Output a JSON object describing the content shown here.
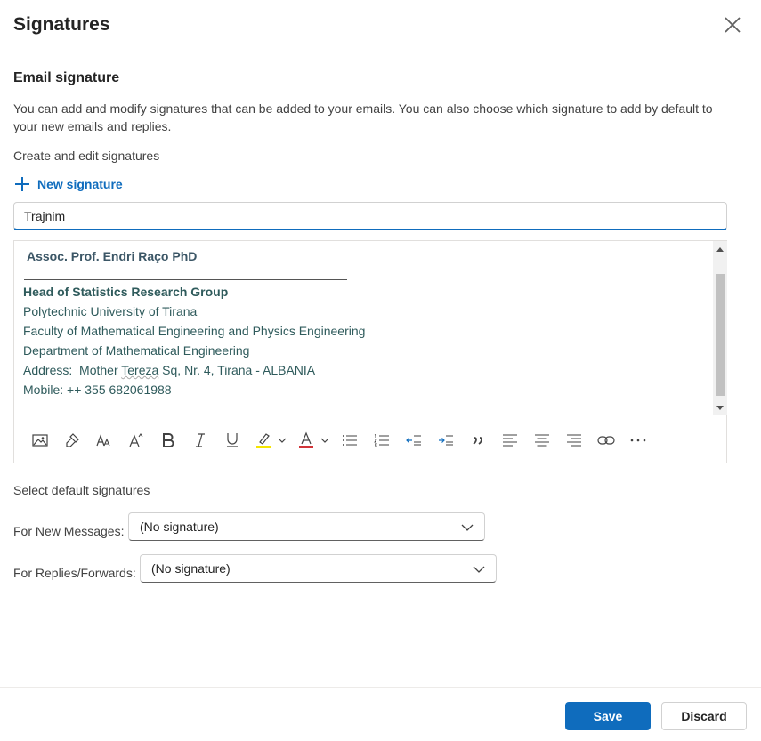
{
  "dialog": {
    "title": "Signatures"
  },
  "email_signature": {
    "heading": "Email signature",
    "description": "You can add and modify signatures that can be added to your emails. You can also choose which signature to add by default to your new emails and replies.",
    "create_label": "Create and edit signatures",
    "new_signature_label": "New signature",
    "signature_name": "Trajnim"
  },
  "signature_body": {
    "name_line": "Assoc. Prof. Endri Raço PhD",
    "title_line": "Head of Statistics Research Group",
    "lines": [
      "Polytechnic University of Tirana",
      "Faculty of Mathematical Engineering and Physics Engineering",
      "Department of Mathematical Engineering"
    ],
    "address_prefix": "Address:  Mother ",
    "address_squiggle": "Tereza",
    "address_suffix": " Sq, Nr. 4, Tirana - ALBANIA",
    "mobile": "Mobile: ++ 355 682061988"
  },
  "toolbar": {
    "icons": [
      "insert-picture-icon",
      "format-painter-icon",
      "font-size-icon",
      "grow-font-icon",
      "bold-icon",
      "italic-icon",
      "underline-icon",
      "highlight-icon",
      "font-color-icon",
      "bullets-icon",
      "numbering-icon",
      "decrease-indent-icon",
      "increase-indent-icon",
      "quote-icon",
      "align-left-icon",
      "align-center-icon",
      "align-right-icon",
      "link-icon",
      "more-options-icon"
    ],
    "highlight_color": "#f5e500",
    "font_color": "#d13438"
  },
  "defaults": {
    "heading": "Select default signatures",
    "new_messages_label": "For New Messages:",
    "new_messages_value": "(No signature)",
    "replies_label": "For Replies/Forwards:",
    "replies_value": "(No signature)"
  },
  "footer": {
    "save_label": "Save",
    "discard_label": "Discard"
  },
  "colors": {
    "accent": "#0f6cbd"
  }
}
